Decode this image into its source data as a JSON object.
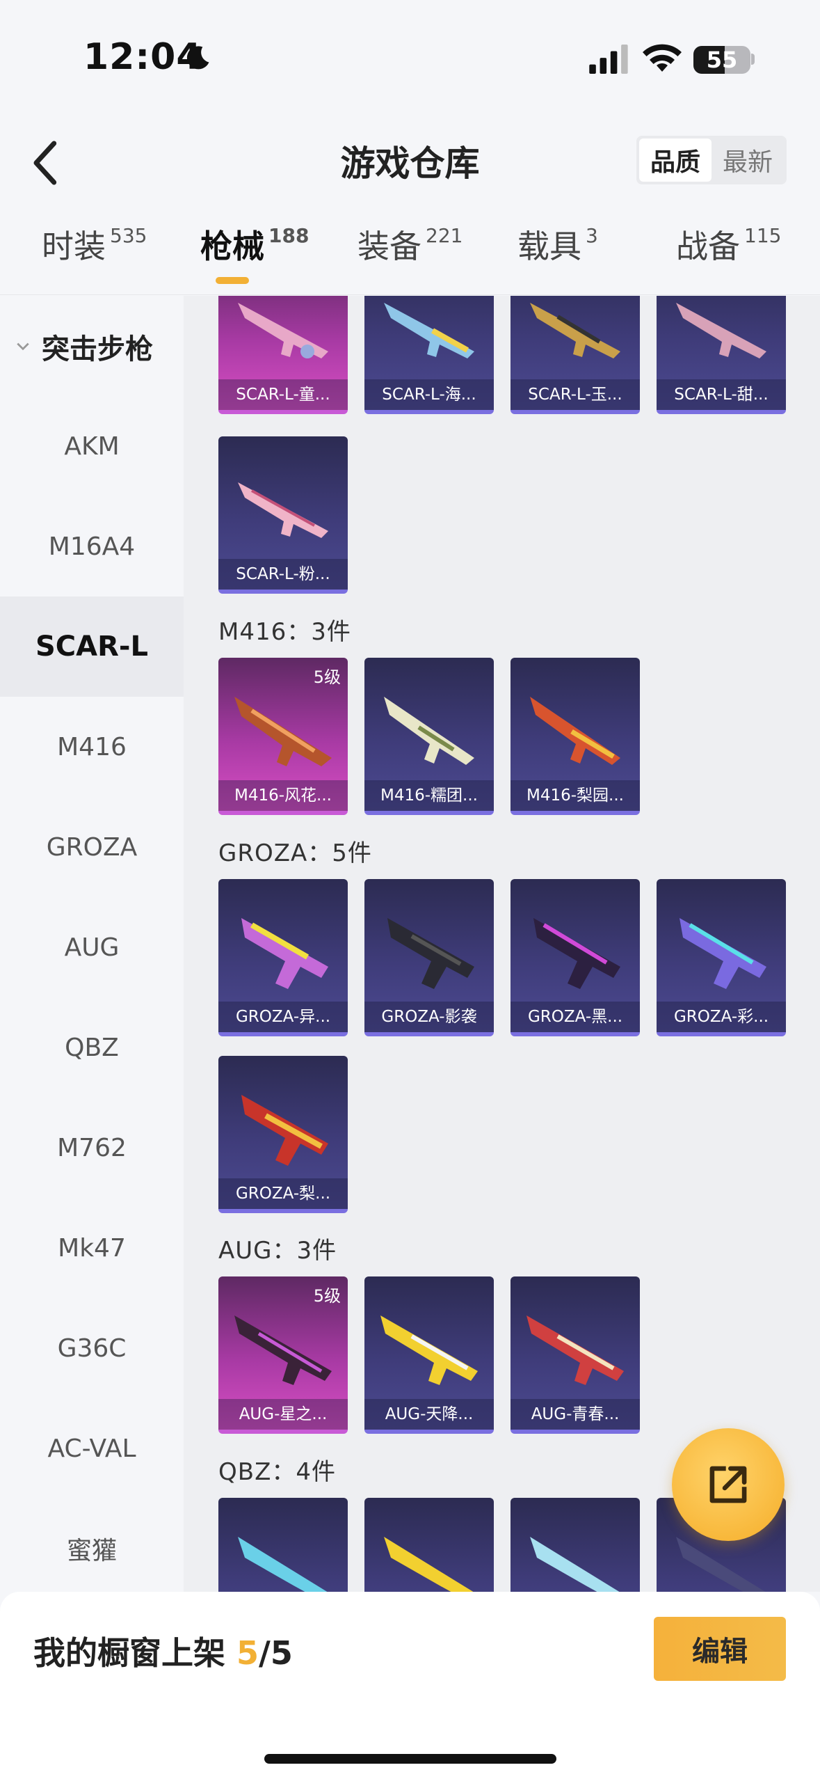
{
  "status": {
    "time": "12:04",
    "battery": "55"
  },
  "header": {
    "title": "游戏仓库",
    "sort_options": [
      "品质",
      "最新"
    ]
  },
  "tabs": [
    {
      "label": "时装",
      "count": "535"
    },
    {
      "label": "枪械",
      "count": "188"
    },
    {
      "label": "装备",
      "count": "221"
    },
    {
      "label": "载具",
      "count": "3"
    },
    {
      "label": "战备",
      "count": "115"
    }
  ],
  "sidebar": {
    "category": "突击步枪",
    "items": [
      "AKM",
      "M16A4",
      "SCAR-L",
      "M416",
      "GROZA",
      "AUG",
      "QBZ",
      "M762",
      "Mk47",
      "G36C",
      "AC-VAL",
      "蜜獾"
    ]
  },
  "groups": {
    "scar_cards": [
      "SCAR-L-童...",
      "SCAR-L-海...",
      "SCAR-L-玉...",
      "SCAR-L-甜...",
      "SCAR-L-粉..."
    ],
    "m416": {
      "title": "M416：3件",
      "cards": [
        "M416-风花...",
        "M416-糯团...",
        "M416-梨园..."
      ],
      "level": "5级"
    },
    "groza": {
      "title": "GROZA：5件",
      "cards": [
        "GROZA-异...",
        "GROZA-影袭",
        "GROZA-黑...",
        "GROZA-彩...",
        "GROZA-梨..."
      ]
    },
    "aug": {
      "title": "AUG：3件",
      "cards": [
        "AUG-星之...",
        "AUG-天降...",
        "AUG-青春..."
      ],
      "level": "5级"
    },
    "qbz": {
      "title": "QBZ：4件"
    }
  },
  "bottom": {
    "shelf_label": "我的橱窗上架",
    "shelf_used": "5",
    "shelf_total": "/5",
    "edit_label": "编辑"
  },
  "colors": {
    "accent": "#f2b035",
    "card_purple": "#3f3c7a",
    "card_pink": "#a83aa4"
  }
}
